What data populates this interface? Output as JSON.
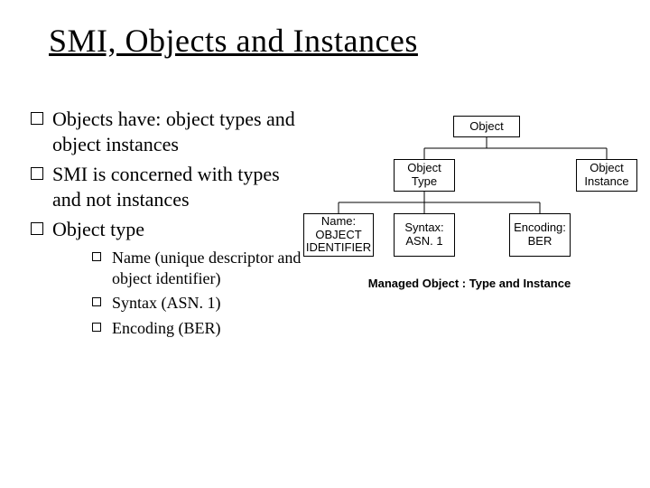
{
  "title": "SMI, Objects and Instances",
  "bullets": {
    "main": [
      "Objects have: object types and object instances",
      "SMI is concerned with types and not instances",
      "Object type"
    ],
    "sub": [
      "Name (unique descriptor and object identifier)",
      "Syntax (ASN. 1)",
      "Encoding (BER)"
    ]
  },
  "diagram": {
    "root": "Object",
    "level2": {
      "left": "Object\nType",
      "right": "Object\nInstance"
    },
    "level3": {
      "a": "Name:\nOBJECT\nIDENTIFIER",
      "b": "Syntax:\nASN. 1",
      "c": "Encoding:\nBER"
    },
    "caption": "Managed Object : Type and Instance"
  }
}
